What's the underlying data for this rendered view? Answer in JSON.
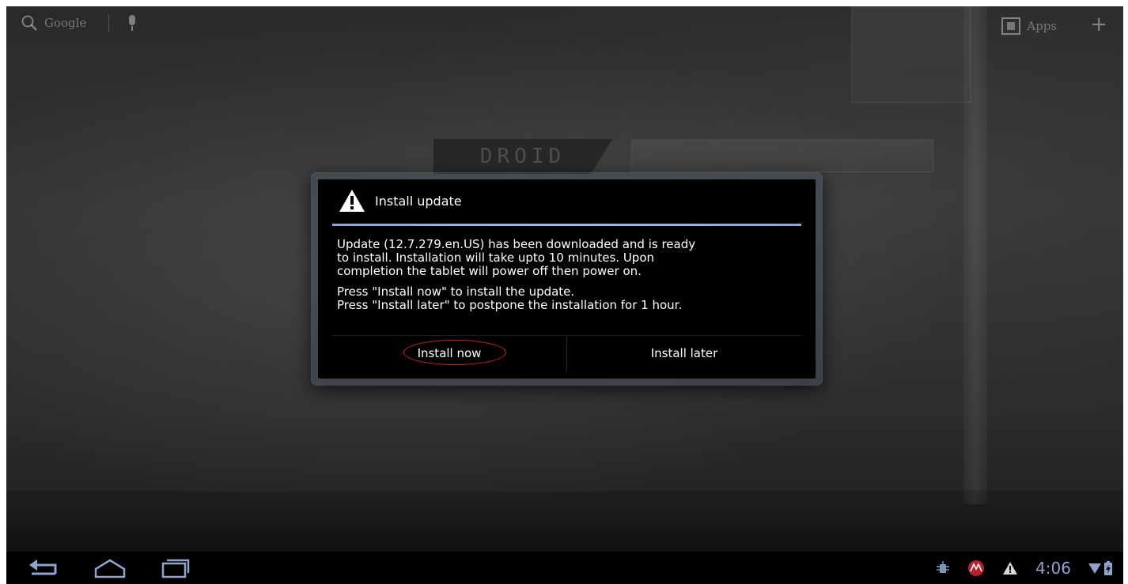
{
  "top_bar": {
    "search_label": "Google",
    "apps_label": "Apps"
  },
  "wallpaper": {
    "badge_text": "DROID"
  },
  "dialog": {
    "title": "Install update",
    "body": {
      "paragraph1": "Update (12.7.279.en.US) has been downloaded and is ready\nto install. Installation will take upto 10 minutes. Upon\ncompletion the tablet will power off then power on.",
      "paragraph2": "Press \"Install now\" to install the update.\nPress \"Install later\" to postpone the installation for 1 hour."
    },
    "buttons": {
      "install_now": "Install now",
      "install_later": "Install later"
    },
    "accent_color": "#9fb6f0",
    "highlight_color": "#e01b1b"
  },
  "system_bar": {
    "clock": "4:06",
    "icons": [
      "back-icon",
      "home-icon",
      "recent-apps-icon",
      "usb-debug-icon",
      "motorola-icon",
      "warning-icon",
      "wifi-icon",
      "battery-icon"
    ]
  }
}
